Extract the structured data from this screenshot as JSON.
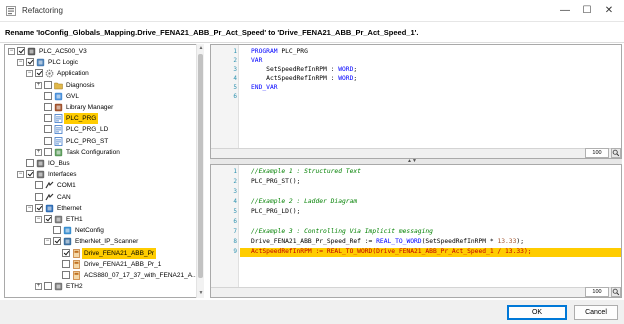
{
  "window": {
    "title": "Refactoring",
    "minimize": "—",
    "maximize": "☐",
    "close": "✕"
  },
  "rename_label": "Rename 'IoConfig_Globals_Mapping.Drive_FENA21_ABB_Pr_Act_Speed' to 'Drive_FENA21_ABB_Pr_Act_Speed_1'.",
  "tree": [
    {
      "label": "PLC_AC500_V3",
      "icon": "plc-device-icon",
      "toggle": "−",
      "checked": true
    },
    {
      "label": "PLC Logic",
      "icon": "plc-logic-icon",
      "toggle": "−",
      "checked": true
    },
    {
      "label": "Application",
      "icon": "application-gear-icon",
      "toggle": "−",
      "checked": true
    },
    {
      "label": "Diagnosis",
      "icon": "folder-icon",
      "toggle": "+",
      "checked": false
    },
    {
      "label": "GVL",
      "icon": "gvl-icon",
      "toggle": "",
      "checked": false
    },
    {
      "label": "Library Manager",
      "icon": "library-manager-icon",
      "toggle": "",
      "checked": false
    },
    {
      "label": "PLC_PRG",
      "icon": "program-icon",
      "toggle": "",
      "checked": false,
      "selected": true
    },
    {
      "label": "PLC_PRG_LD",
      "icon": "program-icon",
      "toggle": "",
      "checked": false
    },
    {
      "label": "PLC_PRG_ST",
      "icon": "program-icon",
      "toggle": "",
      "checked": false
    },
    {
      "label": "Task Configuration",
      "icon": "task-configuration-icon",
      "toggle": "+",
      "checked": false
    },
    {
      "label": "IO_Bus",
      "icon": "io-bus-icon",
      "toggle": "",
      "checked": false
    },
    {
      "label": "Interfaces",
      "icon": "interfaces-icon",
      "toggle": "−",
      "checked": true
    },
    {
      "label": "COM1",
      "icon": "com-port-icon",
      "toggle": "",
      "checked": false
    },
    {
      "label": "CAN",
      "icon": "can-port-icon",
      "toggle": "",
      "checked": false
    },
    {
      "label": "Ethernet",
      "icon": "ethernet-icon",
      "toggle": "−",
      "checked": true
    },
    {
      "label": "ETH1",
      "icon": "eth-port-icon",
      "toggle": "−",
      "checked": true
    },
    {
      "label": "NetConfig",
      "icon": "netconfig-icon",
      "toggle": "",
      "checked": false
    },
    {
      "label": "EtherNet_IP_Scanner",
      "icon": "ethernet-ip-scanner-icon",
      "toggle": "−",
      "checked": true
    },
    {
      "label": "Drive_FENA21_ABB_Pr",
      "icon": "drive-icon",
      "toggle": "",
      "checked": true,
      "selected": true
    },
    {
      "label": "Drive_FENA21_ABB_Pr_1",
      "icon": "drive-icon",
      "toggle": "",
      "checked": false
    },
    {
      "label": "ACS880_07_17_37_with_FENA21_A...",
      "icon": "drive-icon",
      "toggle": "",
      "checked": false
    },
    {
      "label": "ETH2",
      "icon": "eth-port-icon",
      "toggle": "+",
      "checked": false
    }
  ],
  "top_editor": {
    "line_numbers": [
      "1",
      "2",
      "3",
      "4",
      "5",
      "6"
    ],
    "lines": [
      {
        "kw": "PROGRAM",
        "rest": " PLC_PRG"
      },
      {
        "kw": "VAR",
        "rest": ""
      },
      {
        "kw": "",
        "rest": "    SetSpeedRefInRPM : ",
        "type": "WORD",
        "tail": ";"
      },
      {
        "kw": "",
        "rest": "    ActSpeedRefInRPM : ",
        "type": "WORD",
        "tail": ";"
      },
      {
        "kw": "END_VAR",
        "rest": ""
      }
    ],
    "zoom": "100"
  },
  "bottom_editor": {
    "line_numbers": [
      "1",
      "2",
      "3",
      "4",
      "5",
      "6",
      "7",
      "8",
      "9"
    ],
    "line1": "//Example 1 : Structured Text",
    "line2": "PLC_PRG_ST();",
    "line4": "//Example 2 : Ladder Diagram",
    "line5": "PLC_PRG_LD();",
    "line7": "//Example 3 : Controlling Via Implicit messaging",
    "line8_a": "Drive_FENA21_ABB_Pr_Speed_Ref := ",
    "line8_fn": "REAL_TO_WORD",
    "line8_b": "(SetSpeedRefInRPM * ",
    "line8_num": "13.33",
    "line8_c": ");",
    "line9": "ActSpeedRefInRPM := REAL_TO_WORD(Drive_FENA21_ABB_Pr_Act_Speed_1 / 13.33);",
    "zoom": "100"
  },
  "buttons": {
    "ok": "OK",
    "cancel": "Cancel"
  },
  "colors": {
    "selection": "#ffcc00",
    "ok_border": "#0078d7"
  }
}
